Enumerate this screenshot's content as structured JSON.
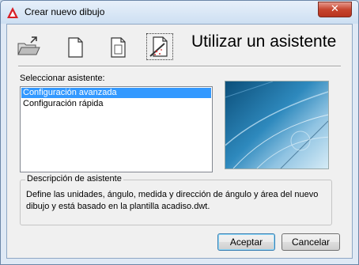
{
  "window": {
    "title": "Crear nuevo dibujo"
  },
  "toolbar": {
    "buttons": [
      {
        "id": "open",
        "icon": "open-folder-icon"
      },
      {
        "id": "start-from-scratch",
        "icon": "blank-document-icon"
      },
      {
        "id": "use-template",
        "icon": "template-document-icon"
      },
      {
        "id": "use-wizard",
        "icon": "wizard-document-icon",
        "active": true
      }
    ],
    "heading": "Utilizar un asistente"
  },
  "wizard": {
    "list_label": "Seleccionar asistente:",
    "items": [
      {
        "label": "Configuración avanzada",
        "selected": true
      },
      {
        "label": "Configuración rápida",
        "selected": false
      }
    ]
  },
  "description": {
    "title": "Descripción de asistente",
    "text": "Define las unidades, ángulo, medida y dirección de ángulo y área del nuevo dibujo y está basado en la plantilla acadiso.dwt."
  },
  "buttons": {
    "ok": "Aceptar",
    "cancel": "Cancelar"
  },
  "colors": {
    "selection": "#3399ff",
    "close_button": "#c7452f",
    "app_icon": "#d81f26"
  }
}
